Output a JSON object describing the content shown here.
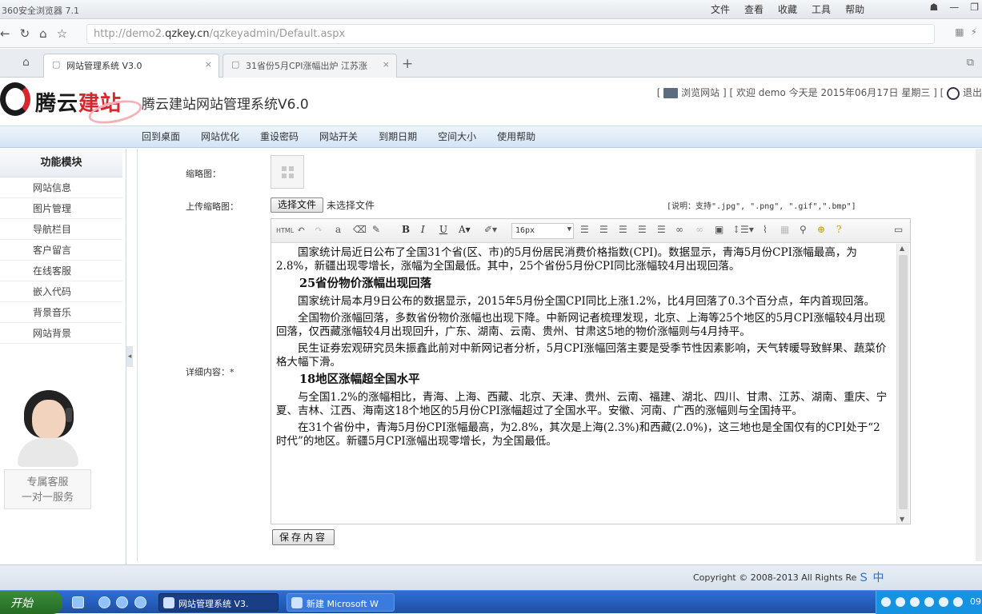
{
  "browser": {
    "title": "360安全浏览器 7.1",
    "menu": [
      "文件",
      "查看",
      "收藏",
      "工具",
      "帮助"
    ],
    "url_prefix": "http://demo2.",
    "url_domain": "qzkey.cn",
    "url_path": "/qzkeyadmin/Default.aspx",
    "tabs": [
      {
        "label": "网站管理系统 V3.0"
      },
      {
        "label": "31省份5月CPI涨幅出炉 江苏涨"
      }
    ]
  },
  "header": {
    "logo_text_a": "腾云",
    "logo_text_b": "建站",
    "system_name": "腾云建站网站管理系统V6.0",
    "browse_site": "浏览网站",
    "welcome": "欢迎 demo 今天是 2015年06月17日 星期三",
    "logout": "退出"
  },
  "nav": [
    "回到桌面",
    "网站优化",
    "重设密码",
    "网站开关",
    "到期日期",
    "空间大小",
    "使用帮助"
  ],
  "sidebar": {
    "title": "功能模块",
    "items": [
      "网站信息",
      "图片管理",
      "导航栏目",
      "客户留言",
      "在线客服",
      "嵌入代码",
      "背景音乐",
      "网站背景"
    ],
    "service_line1": "专属客服",
    "service_line2": "一对一服务"
  },
  "form": {
    "thumb_label": "缩略图：",
    "upload_label": "上传缩略图：",
    "choose_file": "选择文件",
    "no_file": "未选择文件",
    "note": "[说明：支持\".jpg\", \".png\", \".gif\",\".bmp\"]",
    "detail_label": "详细内容：",
    "required_mark": "*",
    "save_button": "保存内容"
  },
  "editor": {
    "font_size": "16px",
    "toolbar_icons": [
      "html-icon",
      "undo-icon",
      "redo-icon",
      "paste-text-icon",
      "eraser-icon",
      "format-painter-icon",
      "bold-icon",
      "italic-icon",
      "underline-icon",
      "font-color-icon",
      "highlight-icon",
      "align-left-icon",
      "align-center-icon",
      "align-right-icon",
      "align-justify-icon",
      "link-icon",
      "unlink-icon",
      "image-icon",
      "line-height-icon",
      "attachment-icon",
      "table-icon",
      "search-icon",
      "zoom-icon",
      "help-icon",
      "fullscreen-icon"
    ],
    "paragraphs": [
      {
        "type": "p",
        "text": "国家统计局近日公布了全国31个省(区、市)的5月份居民消费价格指数(CPI)。数据显示，青海5月份CPI涨幅最高，为2.8%，新疆出现零增长，涨幅为全国最低。其中，25个省份5月份CPI同比涨幅较4月出现回落。"
      },
      {
        "type": "h",
        "text": "25省份物价涨幅出现回落"
      },
      {
        "type": "p",
        "text": "国家统计局本月9日公布的数据显示，2015年5月份全国CPI同比上涨1.2%，比4月回落了0.3个百分点，年内首现回落。"
      },
      {
        "type": "p",
        "text": "全国物价涨幅回落，多数省份物价涨幅也出现下降。中新网记者梳理发现，北京、上海等25个地区的5月CPI涨幅较4月出现回落，仅西藏涨幅较4月出现回升，广东、湖南、云南、贵州、甘肃这5地的物价涨幅则与4月持平。"
      },
      {
        "type": "p",
        "text": "民生证券宏观研究员朱振鑫此前对中新网记者分析，5月CPI涨幅回落主要是受季节性因素影响，天气转暖导致鲜果、蔬菜价格大幅下滑。"
      },
      {
        "type": "h",
        "text": "18地区涨幅超全国水平"
      },
      {
        "type": "p",
        "text": "与全国1.2%的涨幅相比，青海、上海、西藏、北京、天津、贵州、云南、福建、湖北、四川、甘肃、江苏、湖南、重庆、宁夏、吉林、江西、海南这18个地区的5月份CPI涨幅超过了全国水平。安徽、河南、广西的涨幅则与全国持平。"
      },
      {
        "type": "p",
        "text": "在31个省份中，青海5月份CPI涨幅最高，为2.8%，其次是上海(2.3%)和西藏(2.0%)，这三地也是全国仅有的CPI处于“2时代”的地区。新疆5月CPI涨幅出现零增长，为全国最低。"
      }
    ]
  },
  "footer": {
    "copyright": "Copyright © 2008-2013 All Rights Re",
    "ime": "中"
  },
  "taskbar": {
    "start": "开始",
    "tasks": [
      {
        "label": "网站管理系统 V3."
      },
      {
        "label": "新建 Microsoft W"
      }
    ],
    "clock": "09"
  },
  "colors": {
    "brand_red": "#d7262d",
    "nav_bg": "#d4e4f4",
    "taskbar_blue": "#1d4fa6"
  }
}
